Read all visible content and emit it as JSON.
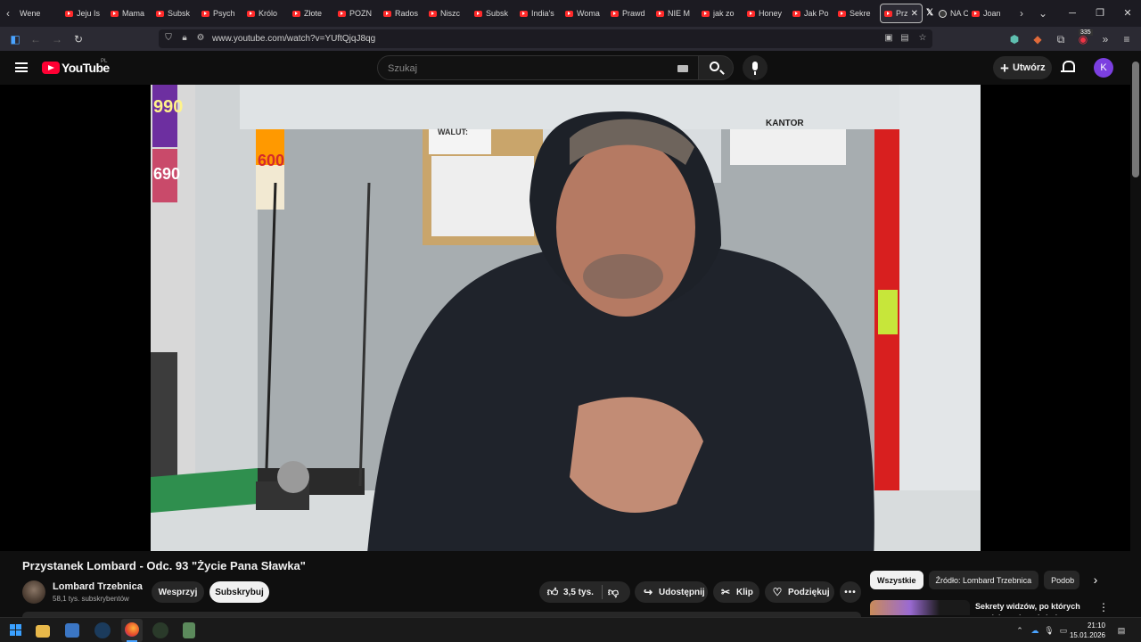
{
  "browser": {
    "tabs": [
      {
        "label": "Wene",
        "favicon": "none"
      },
      {
        "label": "Jeju Is",
        "favicon": "youtube"
      },
      {
        "label": "Mama",
        "favicon": "youtube"
      },
      {
        "label": "Subsk",
        "favicon": "youtube"
      },
      {
        "label": "Psych",
        "favicon": "youtube"
      },
      {
        "label": "Królo",
        "favicon": "youtube"
      },
      {
        "label": "Złote",
        "favicon": "youtube"
      },
      {
        "label": "POZN",
        "favicon": "youtube"
      },
      {
        "label": "Rados",
        "favicon": "youtube"
      },
      {
        "label": "Niszc",
        "favicon": "youtube"
      },
      {
        "label": "Subsk",
        "favicon": "youtube"
      },
      {
        "label": "India's",
        "favicon": "youtube"
      },
      {
        "label": "Woma",
        "favicon": "youtube"
      },
      {
        "label": "Prawd",
        "favicon": "youtube"
      },
      {
        "label": "NIE M",
        "favicon": "youtube"
      },
      {
        "label": "jak zo",
        "favicon": "youtube"
      },
      {
        "label": "Honey",
        "favicon": "youtube"
      },
      {
        "label": "Jak Po",
        "favicon": "youtube"
      },
      {
        "label": "Sekre",
        "favicon": "youtube"
      }
    ],
    "active_tab": {
      "label": "Prz",
      "favicon": "youtube"
    },
    "tabs_after": [
      {
        "label": "NA CZ",
        "favicon": "x-threads"
      },
      {
        "label": "Joan",
        "favicon": "youtube"
      }
    ],
    "url": "www.youtube.com/watch?v=YUftQjqJ8qg",
    "extension_badge": "335"
  },
  "youtube": {
    "logo_text": "YouTube",
    "country_code": "PL",
    "search_placeholder": "Szukaj",
    "create_label": "Utwórz",
    "avatar_letter": "K"
  },
  "video": {
    "title": "Przystanek Lombard - Odc. 93 \"Życie Pana Sławka\"",
    "scene_text": {
      "walut_sign": "WALUT:",
      "kantor_sign": "KANTOR",
      "price_990": "990",
      "price_690": "690",
      "price_600": "600"
    }
  },
  "channel": {
    "name": "Lombard Trzebnica",
    "subscribers": "58,1 tys. subskrybentów",
    "join_label": "Wesprzyj",
    "subscribe_label": "Subskrybuj"
  },
  "actions": {
    "likes": "3,5 tys.",
    "share_label": "Udostępnij",
    "clip_label": "Klip",
    "thanks_label": "Podziękuj",
    "more_label": "•••"
  },
  "recommendations": {
    "chips": [
      "Wszystkie",
      "Źródło: Lombard Trzebnica",
      "Podob"
    ],
    "first_title": "Sekrety widzów, po których musiałam się położyć"
  },
  "taskbar": {
    "time": "21:10",
    "date": "15.01.2026"
  }
}
